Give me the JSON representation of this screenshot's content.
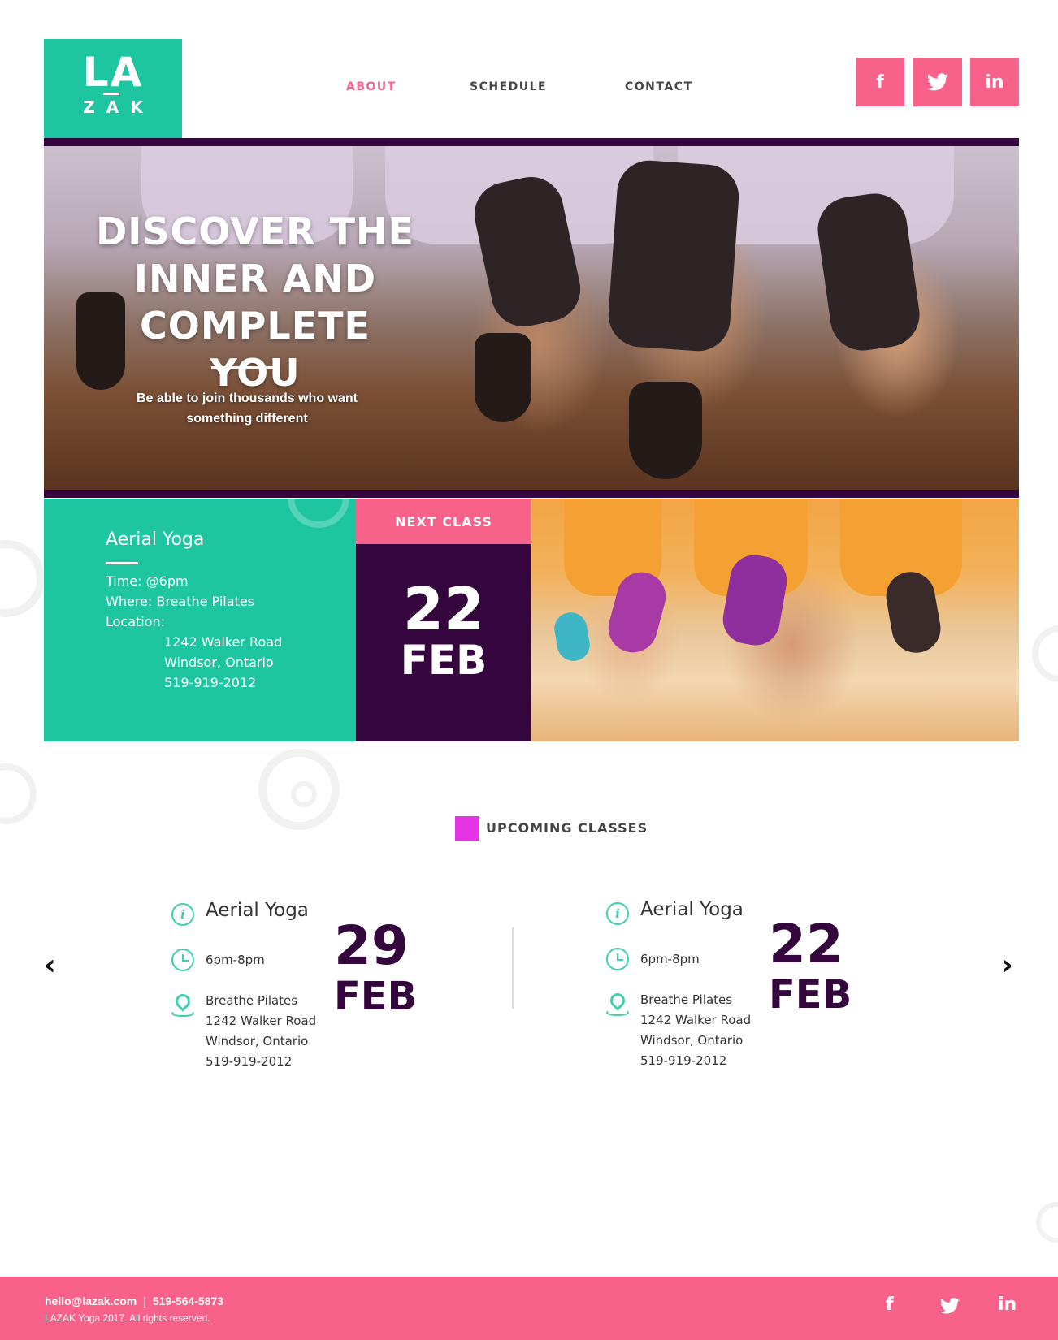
{
  "brand": {
    "logo_top": "LA",
    "logo_bottom": "ZAK",
    "accent": "#1dc5a0",
    "pink": "#f7618a",
    "plum": "#35063d",
    "magenta": "#e534e3"
  },
  "nav": {
    "items": [
      {
        "label": "ABOUT",
        "active": true
      },
      {
        "label": "SCHEDULE",
        "active": false
      },
      {
        "label": "CONTACT",
        "active": false
      }
    ]
  },
  "social": {
    "facebook": "f",
    "twitter": "twitter-icon",
    "linkedin": "in"
  },
  "hero": {
    "title": "DISCOVER THE INNER AND COMPLETE YOU",
    "subtitle": "Be able to join thousands who want something different"
  },
  "next_class": {
    "name": "Aerial Yoga",
    "time": "Time: @6pm",
    "where": "Where: Breathe Pilates",
    "location_label": "Location:",
    "address_line1": "1242 Walker Road",
    "address_line2": "Windsor, Ontario",
    "phone": "519-919-2012",
    "header": "NEXT CLASS",
    "day": "22",
    "month": "FEB"
  },
  "upcoming": {
    "title": "UPCOMING CLASSES",
    "prev_arrow": "‹",
    "next_arrow": "›",
    "cards": [
      {
        "name": "Aerial Yoga",
        "time": "6pm-8pm",
        "venue": "Breathe Pilates",
        "address1": "1242 Walker Road",
        "address2": "Windsor, Ontario",
        "phone": "519-919-2012",
        "day": "29",
        "month": "FEB"
      },
      {
        "name": "Aerial Yoga",
        "time": "6pm-8pm",
        "venue": "Breathe Pilates",
        "address1": "1242 Walker Road",
        "address2": "Windsor, Ontario",
        "phone": "519-919-2012",
        "day": "22",
        "month": "FEB"
      }
    ]
  },
  "footer": {
    "email": "hello@lazak.com",
    "separator": "|",
    "phone": "519-564-5873",
    "copyright": "LAZAK Yoga 2017. All rights reserved.",
    "facebook": "f",
    "linkedin": "in"
  }
}
